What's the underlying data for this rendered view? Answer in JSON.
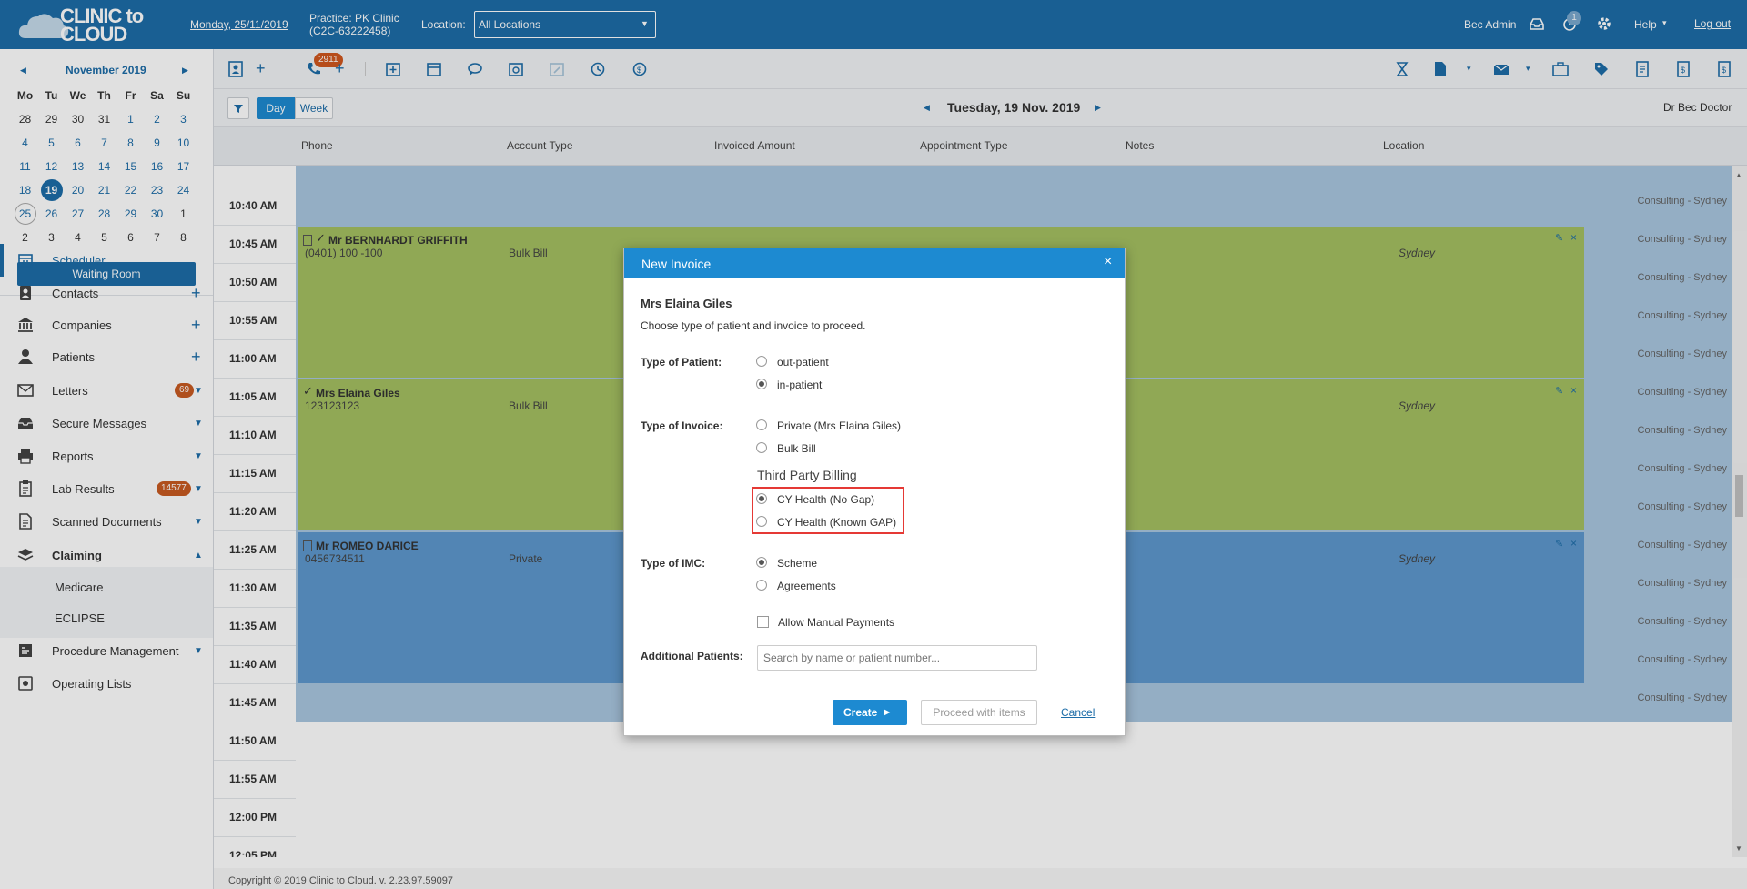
{
  "app": {
    "logo_text": "CLINIC to CLOUD",
    "date_link": "Monday, 25/11/2019",
    "practice_line1": "Practice: PK Clinic",
    "practice_line2": "(C2C-63222458)",
    "location_label": "Location:",
    "location_value": "All Locations",
    "user": "Bec Admin",
    "timer_badge": "1",
    "help": "Help",
    "logout": "Log out"
  },
  "calendar": {
    "month": "November 2019",
    "days": [
      "Mo",
      "Tu",
      "We",
      "Th",
      "Fr",
      "Sa",
      "Su"
    ],
    "weeks": [
      [
        "28",
        "29",
        "30",
        "31",
        "1",
        "2",
        "3"
      ],
      [
        "4",
        "5",
        "6",
        "7",
        "8",
        "9",
        "10"
      ],
      [
        "11",
        "12",
        "13",
        "14",
        "15",
        "16",
        "17"
      ],
      [
        "18",
        "19",
        "20",
        "21",
        "22",
        "23",
        "24"
      ],
      [
        "25",
        "26",
        "27",
        "28",
        "29",
        "30",
        "1"
      ],
      [
        "2",
        "3",
        "4",
        "5",
        "6",
        "7",
        "8"
      ]
    ],
    "selected": "19",
    "today": "25"
  },
  "waiting_room": "Waiting Room",
  "sidebar": {
    "items": [
      {
        "label": "Scheduler",
        "icon": "calendar-icon"
      },
      {
        "label": "Contacts",
        "icon": "contacts-icon"
      },
      {
        "label": "Companies",
        "icon": "bank-icon"
      },
      {
        "label": "Patients",
        "icon": "person-icon"
      },
      {
        "label": "Letters",
        "icon": "envelope-icon",
        "badge": "69"
      },
      {
        "label": "Secure Messages",
        "icon": "inbox-icon"
      },
      {
        "label": "Reports",
        "icon": "printer-icon"
      },
      {
        "label": "Lab Results",
        "icon": "clipboard-icon",
        "badge": "14577"
      },
      {
        "label": "Scanned Documents",
        "icon": "document-icon"
      },
      {
        "label": "Claiming",
        "icon": "layers-icon"
      },
      {
        "label": "Medicare"
      },
      {
        "label": "ECLIPSE"
      },
      {
        "label": "Procedure Management",
        "icon": "procedure-icon"
      },
      {
        "label": "Operating Lists",
        "icon": "operating-icon"
      }
    ]
  },
  "toolbar": {
    "phone_badge": "2911"
  },
  "datebar": {
    "day_btn": "Day",
    "week_btn": "Week",
    "date": "Tuesday, 19 Nov. 2019",
    "doctor": "Dr Bec Doctor"
  },
  "columns": [
    "Phone",
    "Account Type",
    "Invoiced Amount",
    "Appointment Type",
    "Notes",
    "Location"
  ],
  "times": [
    "10:40 AM",
    "10:45 AM",
    "10:50 AM",
    "10:55 AM",
    "11:00 AM",
    "11:05 AM",
    "11:10 AM",
    "11:15 AM",
    "11:20 AM",
    "11:25 AM",
    "11:30 AM",
    "11:35 AM",
    "11:40 AM",
    "11:45 AM",
    "11:50 AM",
    "11:55 AM",
    "12:00 PM",
    "12:05 PM"
  ],
  "slot_location": "Consulting - Sydney",
  "appointments": [
    {
      "name": "Mr BERNHARDT GRIFFITH",
      "phone": "(0401) 100 -100",
      "account": "Bulk Bill",
      "location": "Sydney",
      "color": "#a4c061"
    },
    {
      "name": "Mrs Elaina Giles",
      "phone": "123123123",
      "account": "Bulk Bill",
      "location": "Sydney",
      "color": "#a4c061"
    },
    {
      "name": "Mr ROMEO DARICE",
      "phone": "0456734511",
      "account": "Private",
      "location": "Sydney",
      "color": "#5e98cd"
    }
  ],
  "footer": "Copyright © 2019 Clinic to Cloud. v. 2.23.97.59097",
  "modal": {
    "title": "New Invoice",
    "patient": "Mrs Elaina Giles",
    "instruction": "Choose type of patient and invoice to proceed.",
    "type_of_patient_label": "Type of Patient:",
    "patient_options": [
      "out-patient",
      "in-patient"
    ],
    "type_of_invoice_label": "Type of Invoice:",
    "invoice_options": [
      "Private (Mrs Elaina Giles)",
      "Bulk Bill"
    ],
    "third_party_heading": "Third Party Billing",
    "third_party_options": [
      "CY Health (No Gap)",
      "CY Health (Known GAP)"
    ],
    "type_of_imc_label": "Type of IMC:",
    "imc_options": [
      "Scheme",
      "Agreements"
    ],
    "manual_payments": "Allow Manual Payments",
    "additional_patients_label": "Additional Patients:",
    "search_placeholder": "Search by name or patient number...",
    "create_btn": "Create",
    "proceed_btn": "Proceed with items",
    "cancel_link": "Cancel"
  },
  "colors": {
    "brand_blue": "#1d6da8",
    "modal_header": "#1d8ad1",
    "highlight_red": "#e53935",
    "appt_green": "#a4c061",
    "appt_blue": "#5e98cd",
    "slot_blue": "#a9c6e0"
  }
}
